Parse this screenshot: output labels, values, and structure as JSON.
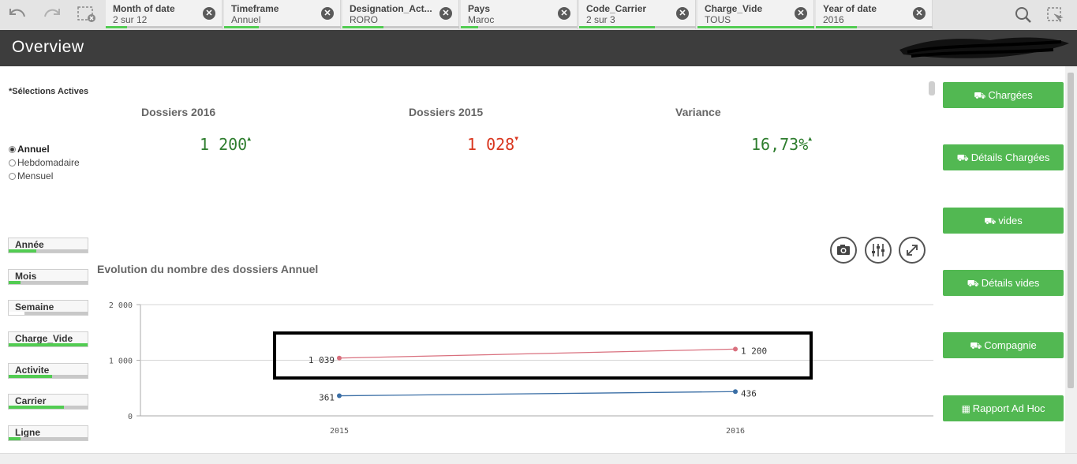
{
  "toolbar": {
    "back_icon": "undo-icon",
    "forward_icon": "redo-icon",
    "clear_icon": "clear-selections-icon",
    "search_icon": "search-icon"
  },
  "selections": [
    {
      "title": "Month of date",
      "value": "2 sur 12",
      "fill": 0.18
    },
    {
      "title": "Timeframe",
      "value": "Annuel",
      "fill": 0.3
    },
    {
      "title": "Designation_Act...",
      "value": "RORO",
      "fill": 0.35
    },
    {
      "title": "Pays",
      "value": "Maroc",
      "fill": 0.15
    },
    {
      "title": "Code_Carrier",
      "value": "2 sur 3",
      "fill": 0.65
    },
    {
      "title": "Charge_Vide",
      "value": "TOUS",
      "fill": 1.0
    },
    {
      "title": "Year of date",
      "value": "2016",
      "fill": 0.35
    }
  ],
  "header": {
    "title": "Overview"
  },
  "active_selections": "*Sélections Actives",
  "timeframe_options": [
    {
      "label": "Annuel",
      "selected": true
    },
    {
      "label": "Hebdomadaire",
      "selected": false
    },
    {
      "label": "Mensuel",
      "selected": false
    }
  ],
  "kpis": [
    {
      "label": "Dossiers 2016",
      "value": "1 200",
      "color": "#2e7d2e",
      "arrow": "▲"
    },
    {
      "label": "Dossiers 2015",
      "value": "1 028",
      "color": "#d9361e",
      "arrow": "▼"
    },
    {
      "label": "Variance",
      "value": "16,73%",
      "color": "#2e7d2e",
      "arrow": "▲"
    }
  ],
  "filters": [
    {
      "label": "Année",
      "fill": 0.35
    },
    {
      "label": "Mois",
      "fill": 0.15
    },
    {
      "label": "Semaine",
      "fill": 0.2
    },
    {
      "label": "Charge_Vide",
      "fill": 1.0
    },
    {
      "label": "Activite",
      "fill": 0.55
    },
    {
      "label": "Carrier",
      "fill": 0.7
    },
    {
      "label": "Ligne",
      "fill": 0.15
    }
  ],
  "side_buttons": [
    {
      "label": "Chargées",
      "icon": "loaded-truck-icon"
    },
    {
      "label": "Détails Chargées",
      "icon": "loaded-truck-details-icon"
    },
    {
      "label": "vides",
      "icon": "empty-truck-icon"
    },
    {
      "label": "Détails vides",
      "icon": "empty-truck-details-icon"
    },
    {
      "label": "Compagnie",
      "icon": "company-truck-icon"
    },
    {
      "label": "Rapport Ad Hoc",
      "icon": "table-icon"
    }
  ],
  "chart_tools": [
    "snapshot-camera-icon",
    "exploration-sliders-icon",
    "fullscreen-expand-icon"
  ],
  "chart_data": {
    "type": "line",
    "title": "Evolution du nombre des dossiers Annuel",
    "categories": [
      "2015",
      "2016"
    ],
    "series": [
      {
        "values": [
          1039,
          1200
        ],
        "labels": [
          "1 039",
          "1 200"
        ],
        "color": "#d9707e"
      },
      {
        "values": [
          361,
          436
        ],
        "labels": [
          "361",
          "436"
        ],
        "color": "#3a6ea5"
      }
    ],
    "ylim": [
      0,
      2000
    ],
    "yticks": [
      {
        "value": 0,
        "label": "0"
      },
      {
        "value": 1000,
        "label": "1 000"
      },
      {
        "value": 2000,
        "label": "2 000"
      }
    ],
    "grid": true,
    "highlight_box": "around-upper-series"
  }
}
